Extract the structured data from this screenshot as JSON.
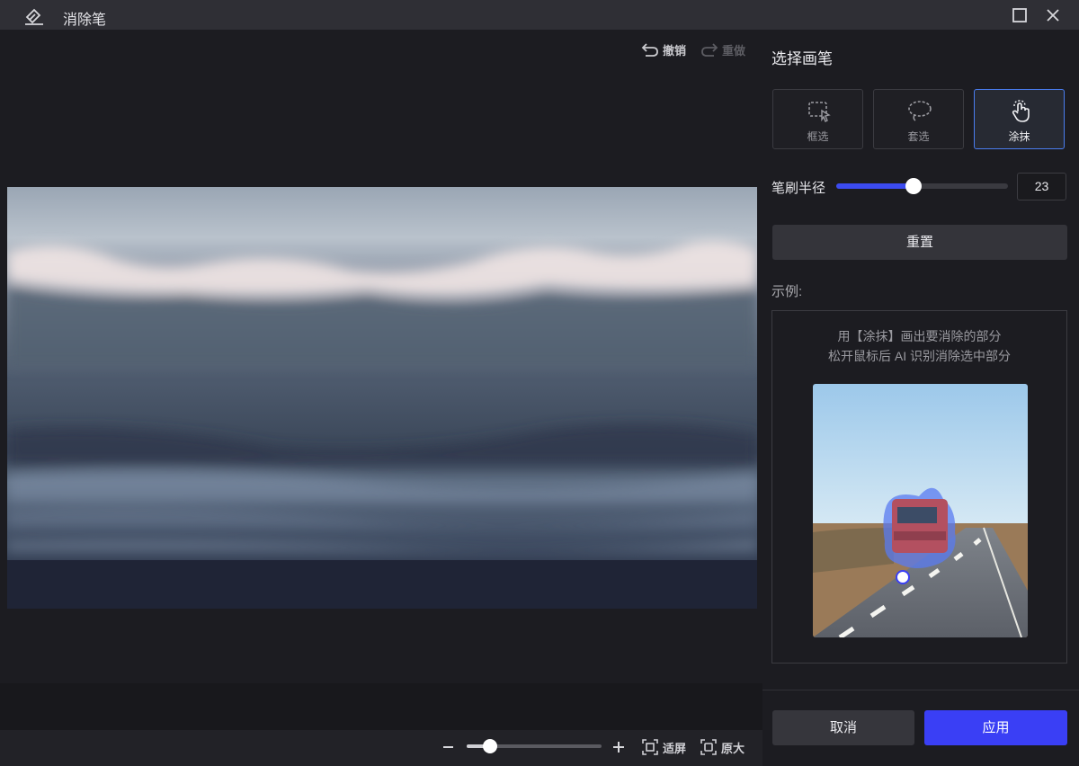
{
  "window": {
    "title": "消除笔",
    "app_icon": "eraser-icon",
    "buttons": [
      "maximize-icon",
      "close-icon"
    ]
  },
  "canvas": {
    "undo_label": "撤销",
    "redo_label": "重做",
    "zoom": {
      "level": 0.17,
      "fit_label": "适屏",
      "original_label": "原大"
    }
  },
  "panel": {
    "title": "选择画笔",
    "brushes": [
      {
        "label": "框选",
        "icon": "rect-select-icon",
        "selected": false
      },
      {
        "label": "套选",
        "icon": "lasso-icon",
        "selected": false
      },
      {
        "label": "涂抹",
        "icon": "hand-smear-icon",
        "selected": true
      }
    ],
    "radius": {
      "label": "笔刷半径",
      "value": "23",
      "fraction": 0.45
    },
    "reset_label": "重置",
    "example": {
      "label": "示例:",
      "line1": "用【涂抹】画出要消除的部分",
      "line2": "松开鼠标后 AI 识别消除选中部分"
    },
    "cancel_label": "取消",
    "apply_label": "应用"
  },
  "colors": {
    "accent": "#3a3ff5",
    "selected_border": "#4a7df0",
    "background": "#1c1c21"
  }
}
